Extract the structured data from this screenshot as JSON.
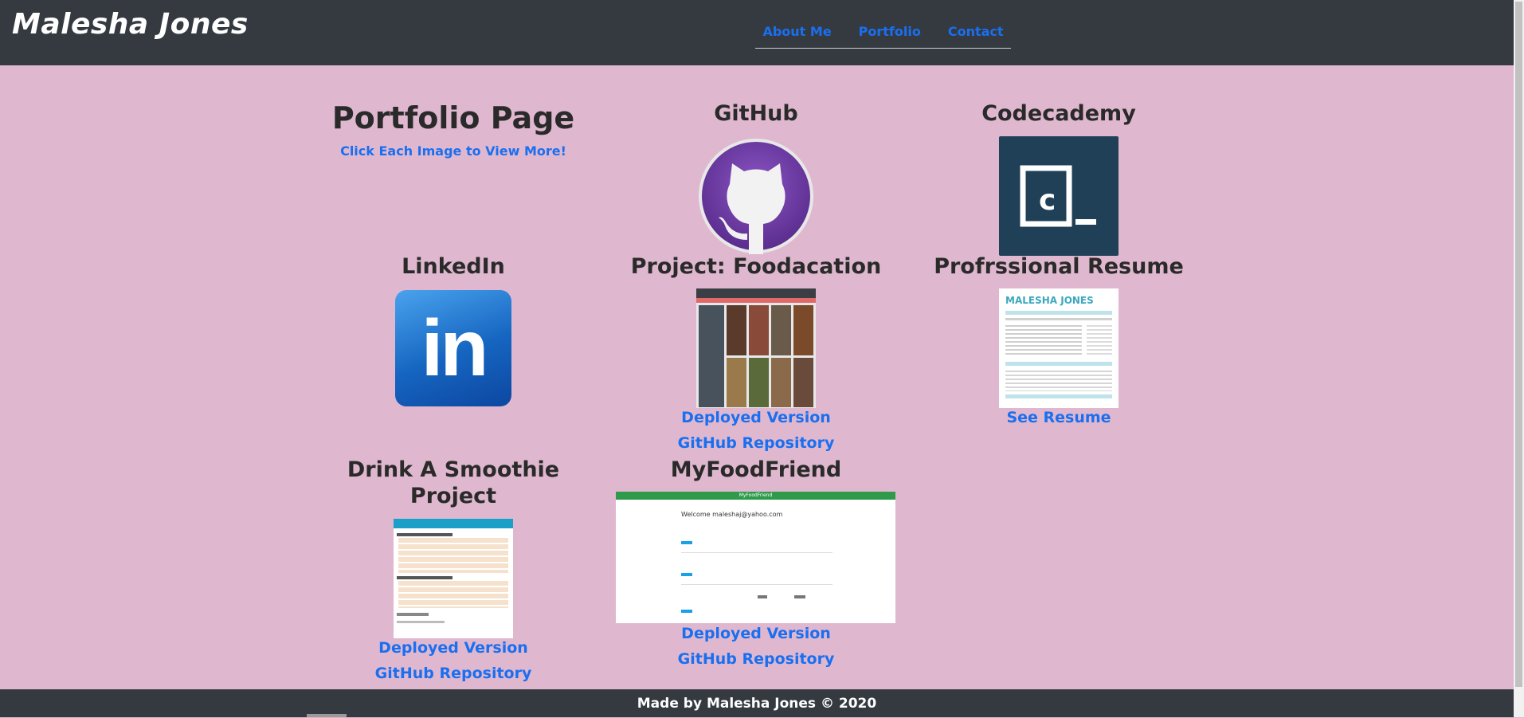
{
  "header": {
    "brand": "Malesha Jones",
    "nav": [
      "About Me",
      "Portfolio",
      "Contact"
    ]
  },
  "portfolio": {
    "title": "Portfolio Page",
    "subtitle": "Click Each Image to View More!"
  },
  "cards": {
    "github": {
      "title": "GitHub"
    },
    "codecademy": {
      "title": "Codecademy",
      "icon_text": "C_"
    },
    "linkedin": {
      "title": "LinkedIn",
      "icon_text": "in"
    },
    "foodacation": {
      "title": "Project: Foodacation",
      "links": [
        "Deployed Version",
        "GitHub Repository"
      ]
    },
    "resume": {
      "title": "Profrssional Resume",
      "link": "See Resume",
      "preview_name": "MALESHA JONES"
    },
    "smoothie": {
      "title_line1": "Drink A Smoothie",
      "title_line2": "Project",
      "links": [
        "Deployed Version",
        "GitHub Repository"
      ]
    },
    "myfoodfriend": {
      "title": "MyFoodFriend",
      "preview_header": "MyFoodFriend",
      "preview_welcome": "Welcome maleshaj@yahoo.com",
      "links": [
        "Deployed Version",
        "GitHub Repository"
      ]
    }
  },
  "footer": {
    "text": "Made by Malesha Jones © 2020"
  },
  "colors": {
    "background": "#dfb8cf",
    "navbar": "#343a40",
    "link": "#1a6ff0",
    "github_purple": "#6e3fa3",
    "codecademy_navy": "#204057",
    "linkedin_blue": "#1565c0"
  }
}
